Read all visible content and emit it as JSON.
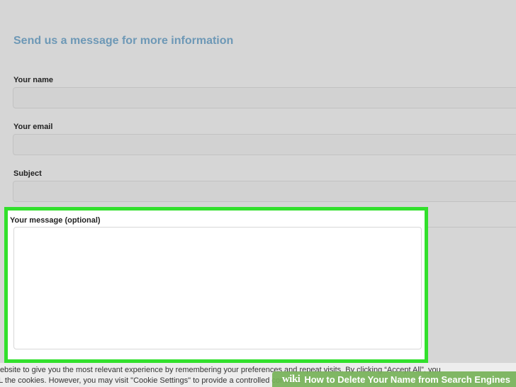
{
  "form": {
    "title": "Send us a message for more information",
    "fields": [
      {
        "label": "Your name",
        "value": ""
      },
      {
        "label": "Your email",
        "value": ""
      },
      {
        "label": "Subject",
        "value": ""
      }
    ],
    "message": {
      "label": "Your message (optional)",
      "value": ""
    }
  },
  "cookie_notice": {
    "line1": "website to give you the most relevant experience by remembering your preferences and repeat visits. By clicking “Accept All”, you",
    "line2": "LL the cookies. However, you may visit \"Cookie Settings\" to provide a controlled consent."
  },
  "watermark": {
    "logo": "wiki",
    "title": "How to Delete Your Name from Search Engines"
  },
  "colors": {
    "highlight": "#32e02c",
    "title_blue": "#6d98b6",
    "watermark_green": "#76b258"
  }
}
